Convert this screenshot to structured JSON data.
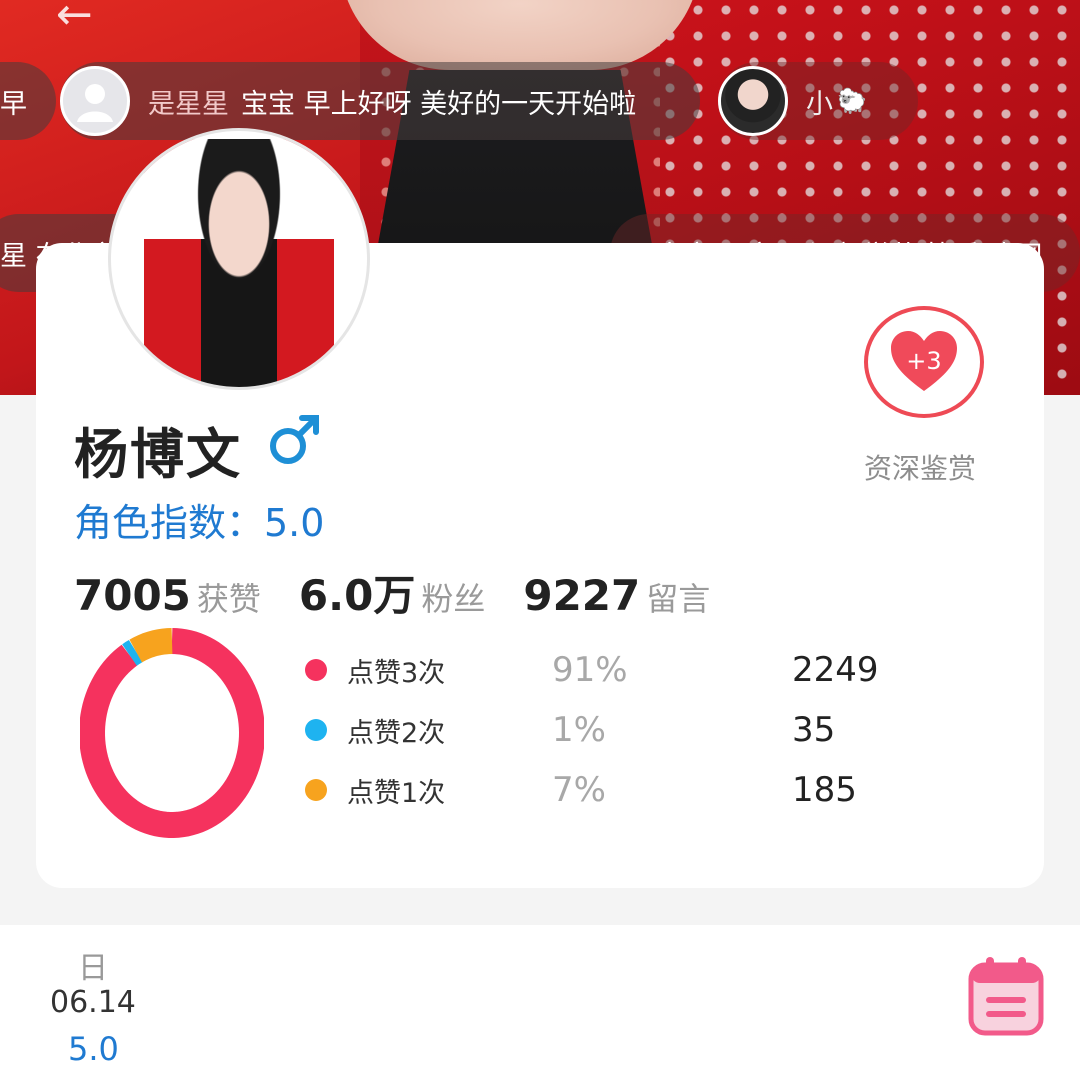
{
  "header": {
    "back_icon": "back-arrow-icon",
    "back_glyph": "←"
  },
  "danmaku": [
    {
      "prefix": "早"
    },
    {
      "user": "是星星",
      "text": "宝宝 早上好呀 美好的一天开始啦"
    },
    {
      "user": "小",
      "emoji": "🐑"
    },
    {
      "text": "星 在北京城"
    },
    {
      "text": "…安宝  天空…  还想学苗  快乐  欢网"
    }
  ],
  "profile": {
    "name": "杨博文",
    "gender_symbol": "♂",
    "role_index": "角色指数：5.0"
  },
  "stats": [
    {
      "value": "7005",
      "label": "获赞"
    },
    {
      "value": "6.0万",
      "label": "粉丝"
    },
    {
      "value": "9227",
      "label": "留言"
    }
  ],
  "reward": {
    "badge": "+3",
    "label": "资深鉴赏"
  },
  "chart_data": {
    "type": "pie",
    "categories": [
      "点赞3次",
      "点赞2次",
      "点赞1次"
    ],
    "percentages": [
      "91%",
      "1%",
      "7%"
    ],
    "counts": [
      2249,
      35,
      185
    ],
    "values": [
      2249,
      35,
      185
    ],
    "colors": [
      "#f5325e",
      "#1eb3f0",
      "#f7a31e"
    ]
  },
  "colors": {
    "accent_blue": "#1f7ad1",
    "accent_red": "#ee4a55"
  },
  "footer": {
    "day": "日",
    "date": "06.14",
    "score": "5.0",
    "calendar_icon": "calendar-icon"
  }
}
